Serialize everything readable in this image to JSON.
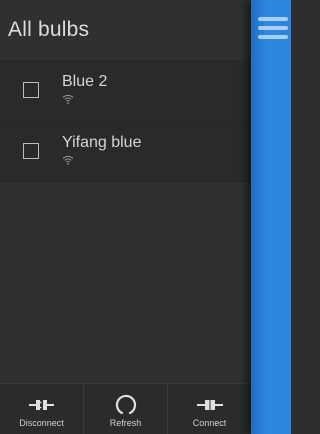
{
  "drawer": {
    "title": "All bulbs"
  },
  "bulbs": [
    {
      "name": "Blue 2",
      "checked": false,
      "signal_icon": "wifi-icon"
    },
    {
      "name": "Yifang blue",
      "checked": false,
      "signal_icon": "wifi-icon"
    }
  ],
  "toolbar": {
    "disconnect_label": "Disconnect",
    "refresh_label": "Refresh",
    "connect_label": "Connect"
  },
  "colors": {
    "accent_blue": "#2c86de",
    "drawer_bg": "#303030",
    "text": "#d6d6d6"
  }
}
